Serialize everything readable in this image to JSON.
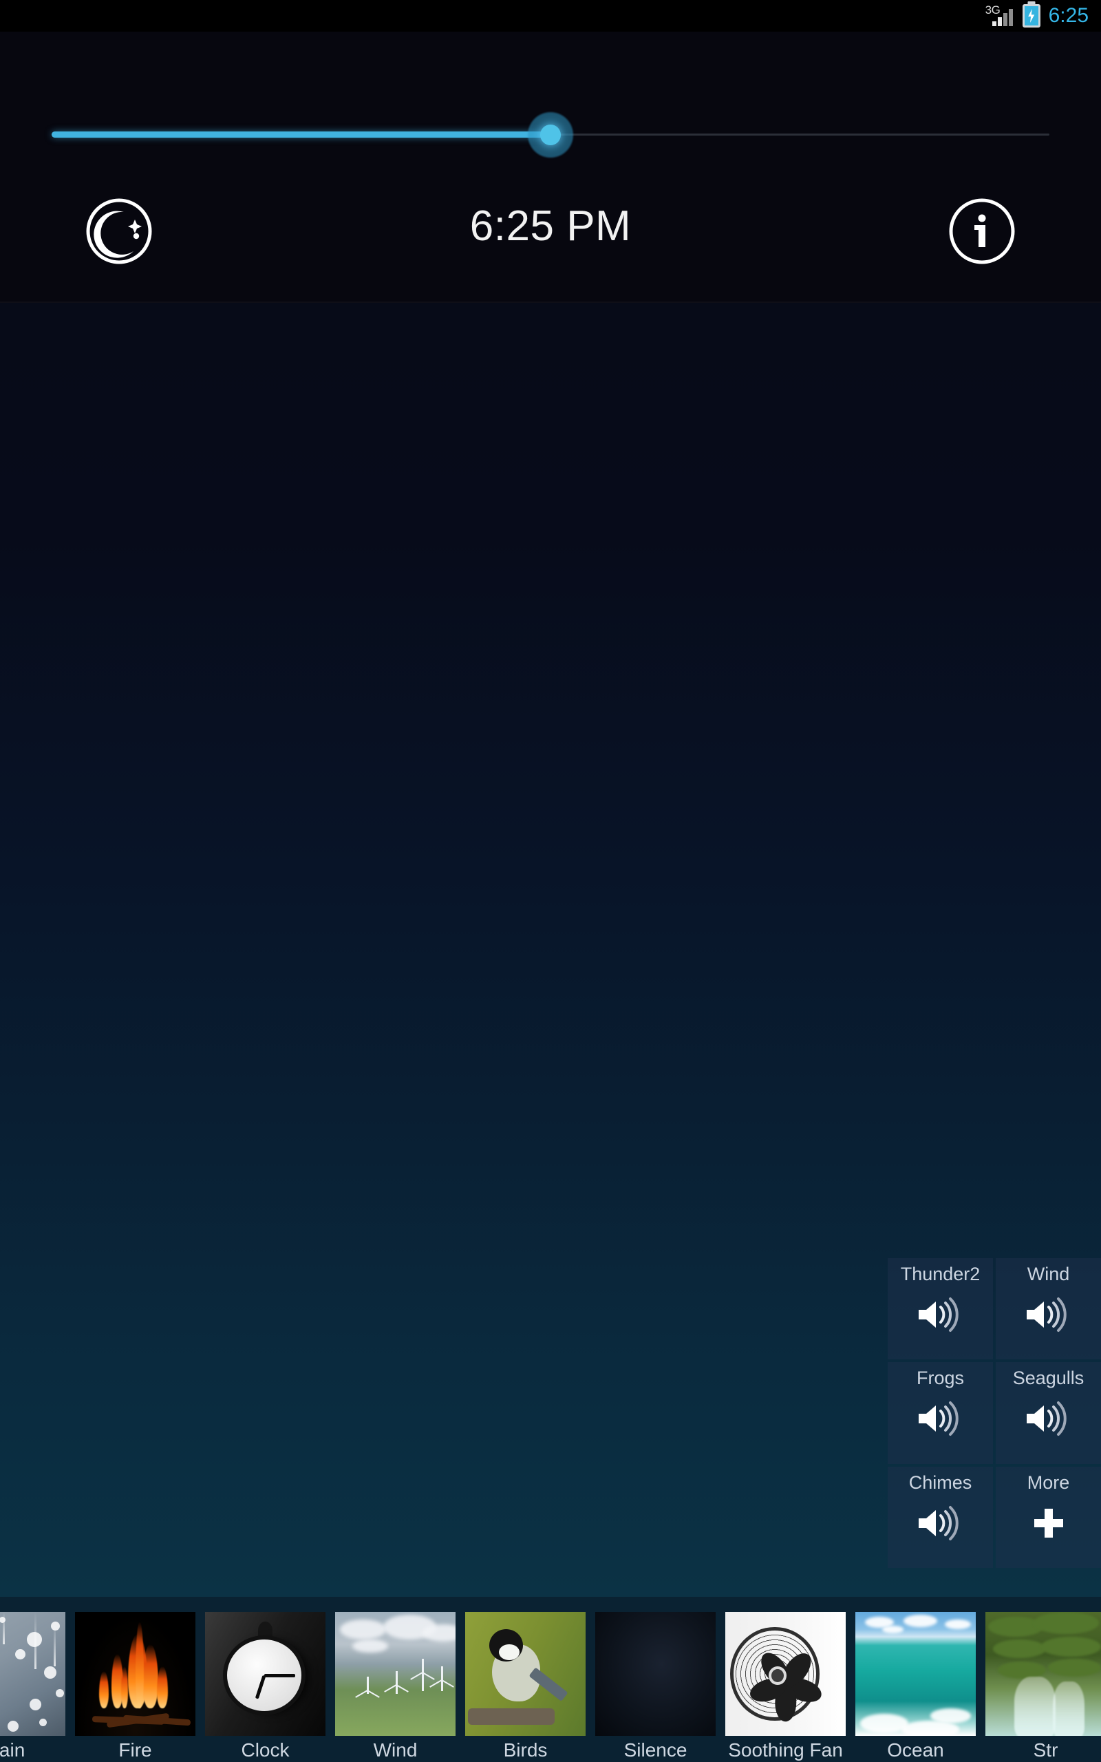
{
  "statusbar": {
    "network_label": "3G",
    "time": "6:25",
    "signal_icon": "signal-bars-icon",
    "battery_icon": "battery-charging-icon",
    "time_color": "#35b7e8"
  },
  "top_panel": {
    "slider": {
      "name": "volume-slider",
      "value_percent": 50,
      "fill_color": "#41b3e0",
      "thumb_color": "#4fc3e8",
      "track_color": "#2b2f38"
    },
    "night_mode": {
      "label": "",
      "icon": "moon-stars-icon"
    },
    "clock": {
      "time": "6:25 PM"
    },
    "info": {
      "label": "",
      "icon": "info-circle-icon"
    }
  },
  "sound_panel": {
    "cells": [
      {
        "label": "Thunder2",
        "icon": "speaker-icon"
      },
      {
        "label": "Wind",
        "icon": "speaker-icon"
      },
      {
        "label": "Frogs",
        "icon": "speaker-icon"
      },
      {
        "label": "Seagulls",
        "icon": "speaker-icon"
      },
      {
        "label": "Chimes",
        "icon": "speaker-icon"
      },
      {
        "label": "More",
        "icon": "plus-icon"
      }
    ]
  },
  "thumb_strip": {
    "items": [
      {
        "label": "Rain",
        "art": "rain"
      },
      {
        "label": "Fire",
        "art": "fire"
      },
      {
        "label": "Clock",
        "art": "clock"
      },
      {
        "label": "Wind",
        "art": "wind"
      },
      {
        "label": "Birds",
        "art": "birds"
      },
      {
        "label": "Silence",
        "art": "silence"
      },
      {
        "label": "Soothing Fan",
        "art": "fan"
      },
      {
        "label": "Ocean",
        "art": "ocean"
      },
      {
        "label": "Str",
        "art": "stream"
      }
    ]
  }
}
